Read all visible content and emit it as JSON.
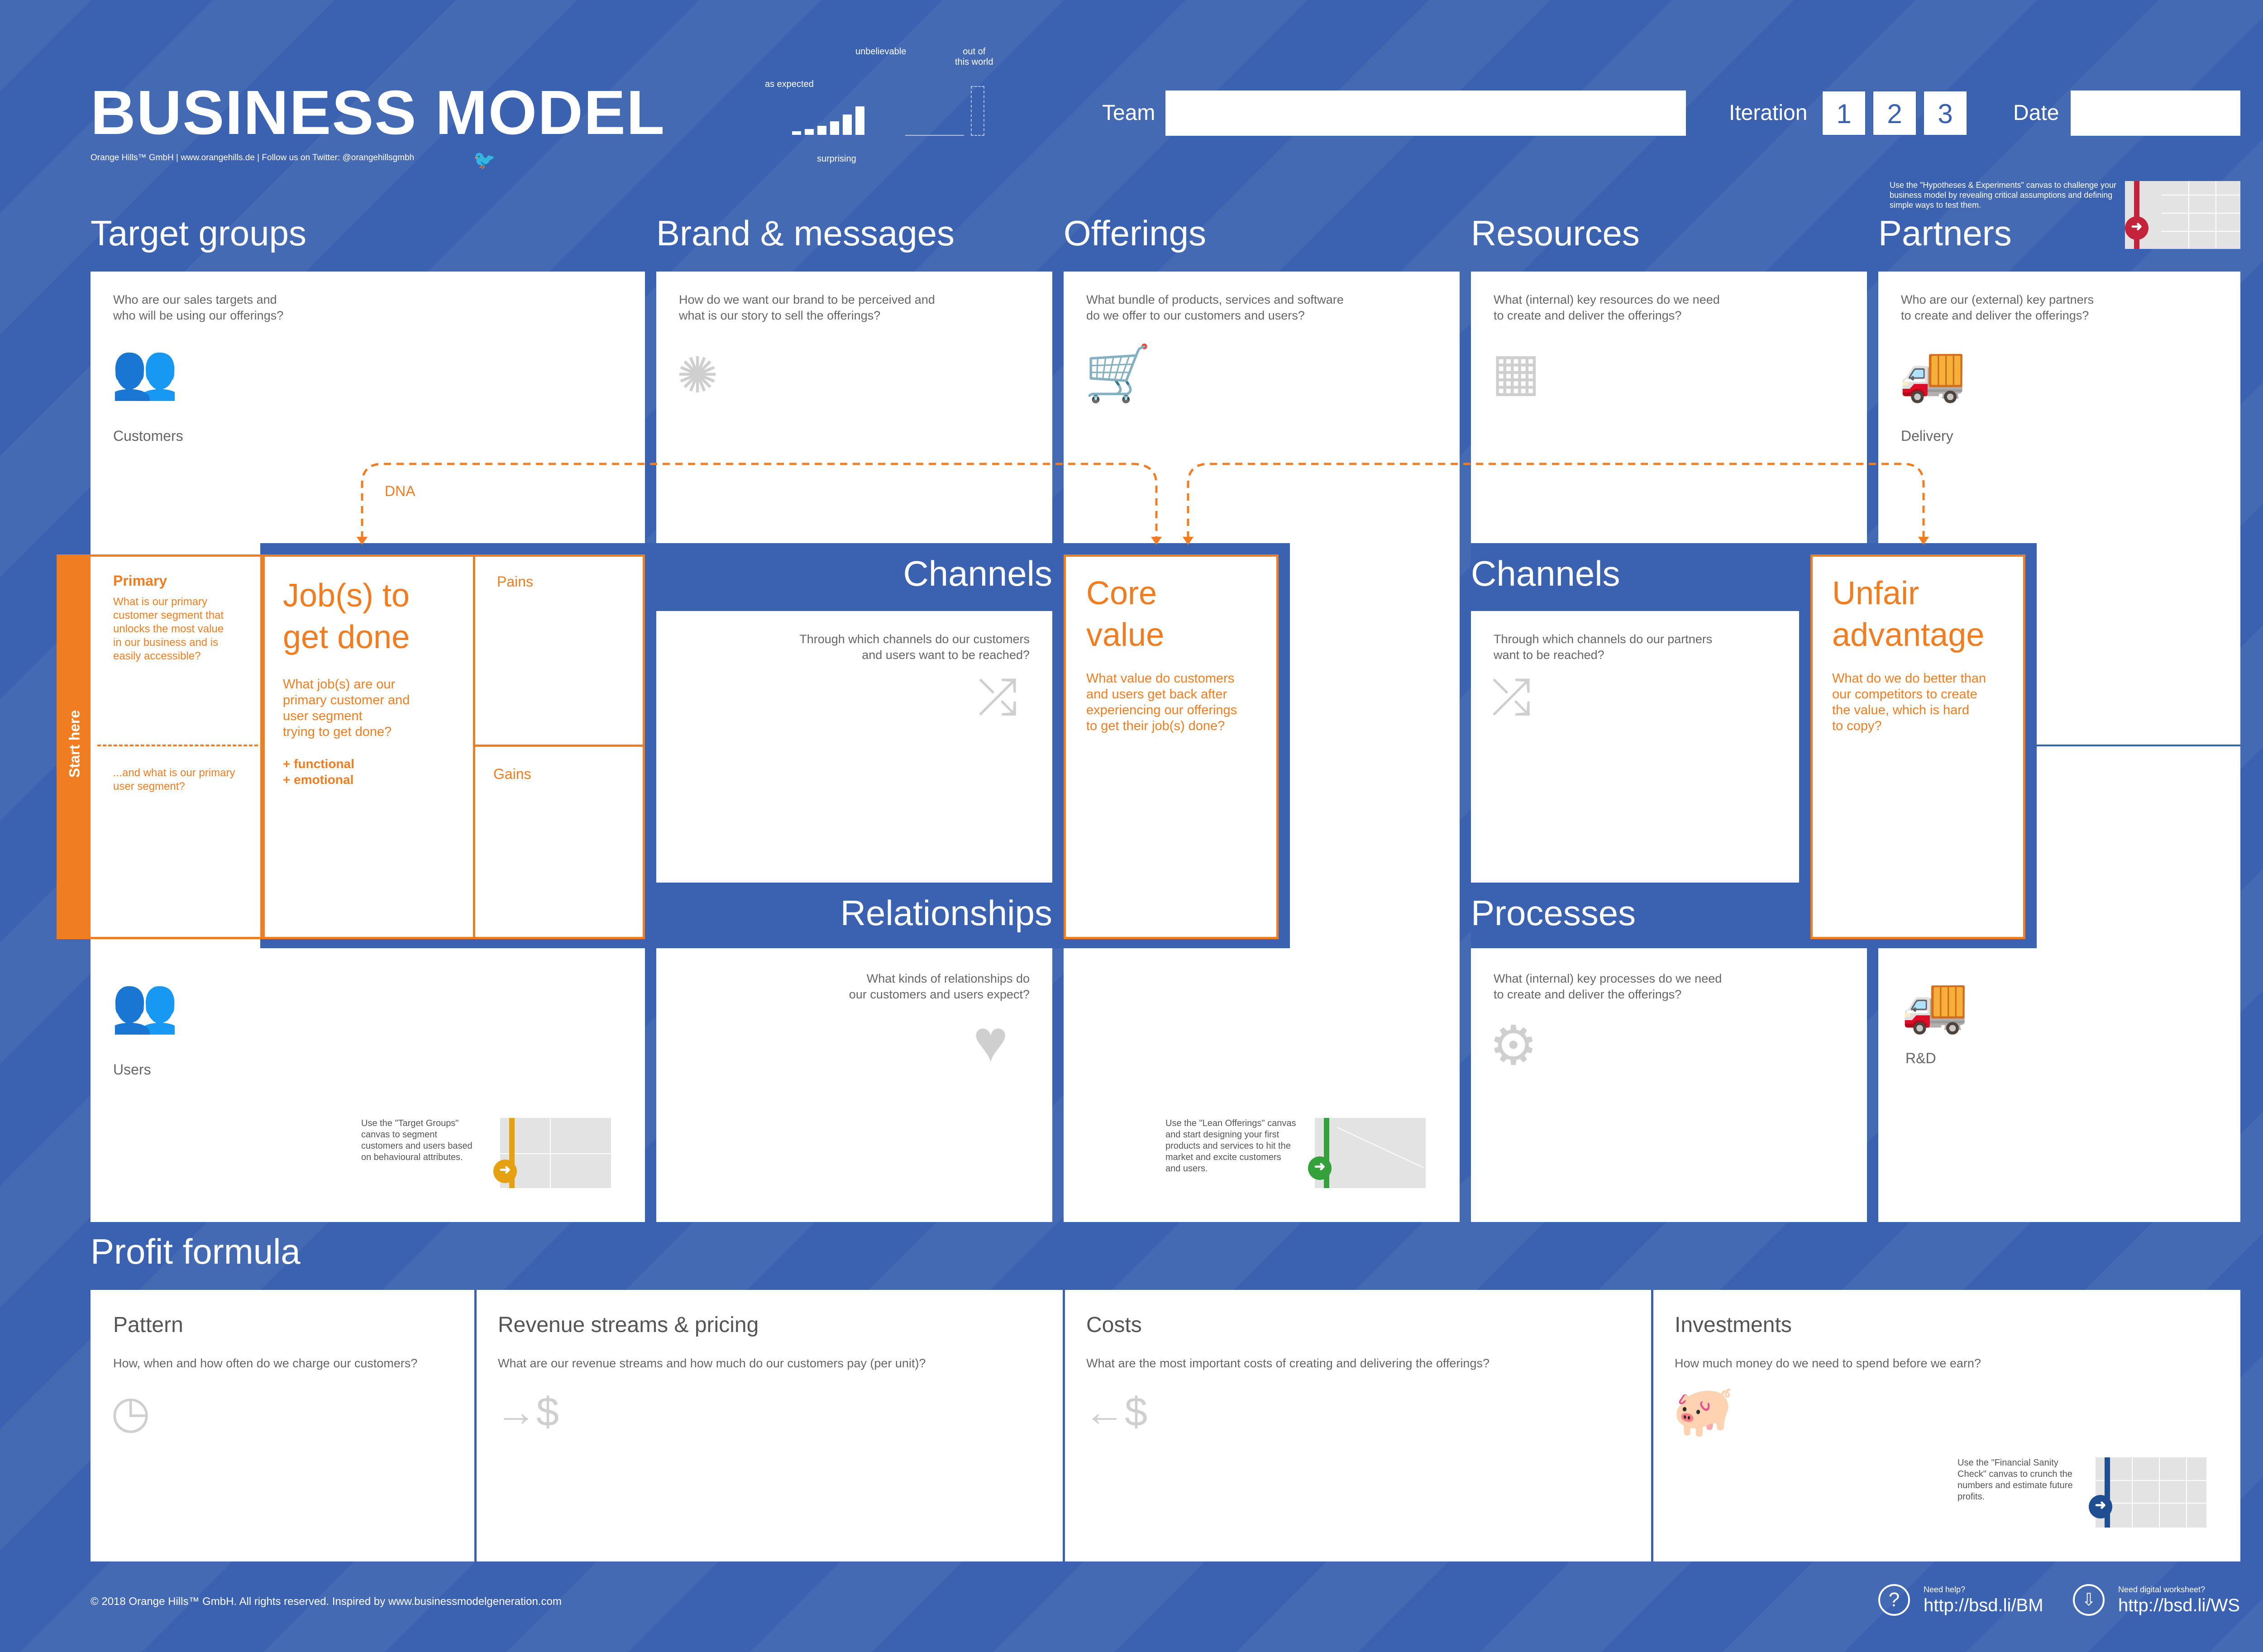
{
  "header": {
    "title": "BUSINESS MODEL",
    "subtitle": "Orange Hills™ GmbH | www.orangehills.de | Follow us on Twitter: @orangehillsgmbh",
    "team_label": "Team",
    "iteration_label": "Iteration",
    "iterations": [
      "1",
      "2",
      "3"
    ],
    "date_label": "Date",
    "scale": {
      "as_expected": "as expected",
      "unbelievable": "unbelievable",
      "out_of_this_world": "out of\nthis world",
      "surprising": "surprising"
    }
  },
  "hypotheses_hint": "Use the \"Hypotheses & Experiments\" canvas to challenge your business model by revealing critical assumptions and defining simple ways to test them.",
  "sections": {
    "target_groups": {
      "title": "Target groups",
      "question": "Who are our sales targets and\nwho will be using our offerings?",
      "customers": "Customers",
      "users": "Users",
      "dna": "DNA",
      "hint": "Use the \"Target Groups\"\ncanvas to segment\ncustomers and users based\non behavioural attributes."
    },
    "brand": {
      "title": "Brand & messages",
      "question": "How do we want our brand to be perceived and\nwhat is our story to sell the offerings?"
    },
    "offerings": {
      "title": "Offerings",
      "question": "What bundle of products, services and software\ndo we offer to our customers and users?",
      "hint": "Use the \"Lean Offerings\" canvas\nand start designing your first\nproducts and services to hit the\nmarket and excite customers\nand users."
    },
    "resources": {
      "title": "Resources",
      "question": "What (internal) key resources do we need\nto create and deliver the offerings?"
    },
    "partners": {
      "title": "Partners",
      "question": "Who are our (external) key partners\nto create and deliver the offerings?",
      "delivery": "Delivery",
      "rnd": "R&D"
    },
    "start_here": "Start here",
    "primary": {
      "title": "Primary",
      "text": "What is our primary\ncustomer segment that\nunlocks the most value\nin our business and is\neasily accessible?",
      "secondary": "...and what is our primary\nuser segment?"
    },
    "jobs": {
      "title": "Job(s) to\nget done",
      "text": "What job(s) are our\nprimary customer and\nuser segment\ntrying to get done?",
      "functional": "+ functional",
      "emotional": "+ emotional",
      "pains": "Pains",
      "gains": "Gains"
    },
    "channels_left": {
      "title": "Channels",
      "question": "Through which channels do our customers\nand users want to be reached?"
    },
    "relationships": {
      "title": "Relationships",
      "question": "What kinds of relationships do\nour customers and users expect?"
    },
    "core_value": {
      "title": "Core\nvalue",
      "text": "What value do customers\nand users get back after\nexperiencing our offerings\nto get their job(s) done?"
    },
    "channels_right": {
      "title": "Channels",
      "question": "Through which channels do our partners\nwant to be reached?"
    },
    "processes": {
      "title": "Processes",
      "question": "What (internal) key processes do we need\nto create and deliver the offerings?"
    },
    "unfair": {
      "title": "Unfair\nadvantage",
      "text": "What do we do better than\nour competitors to create\nthe value, which is hard\nto copy?"
    }
  },
  "profit": {
    "title": "Profit formula",
    "pattern": {
      "title": "Pattern",
      "question": "How, when and how often do we charge our customers?"
    },
    "revenue": {
      "title": "Revenue streams & pricing",
      "question": "What are our revenue streams and how much do our customers pay (per unit)?"
    },
    "costs": {
      "title": "Costs",
      "question": "What are the most important costs of creating and delivering the offerings?"
    },
    "investments": {
      "title": "Investments",
      "question": "How much money do we need to spend before we earn?",
      "hint": "Use the \"Financial Sanity\nCheck\" canvas to crunch the\nnumbers and estimate future\nprofits."
    }
  },
  "footer": {
    "copyright": "© 2018 Orange Hills™ GmbH. All rights reserved. Inspired by www.businessmodelgeneration.com",
    "help_label": "Need help?",
    "help_url": "http://bsd.li/BM",
    "ws_label": "Need digital worksheet?",
    "ws_url": "http://bsd.li/WS"
  },
  "colors": {
    "background": "#3a62b0",
    "accent": "#f07d21",
    "panel": "#ffffff",
    "icon": "#cfcfcf"
  }
}
